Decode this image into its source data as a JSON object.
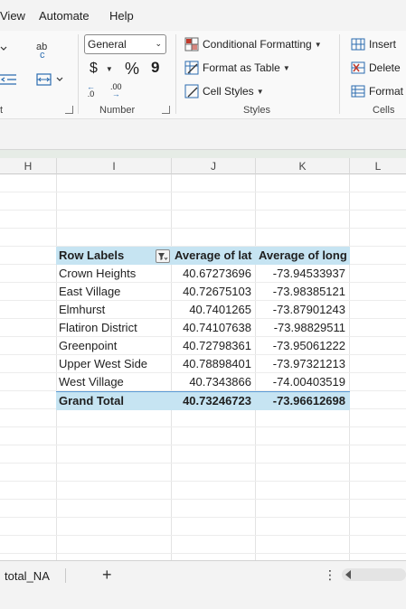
{
  "menubar": {
    "items": [
      "View",
      "Automate",
      "Help"
    ]
  },
  "ribbon": {
    "alignment": {
      "group_label_partial": "t",
      "wrap_glyph": "ab",
      "wrap_glyph2": "c"
    },
    "number": {
      "format_value": "General",
      "currency_symbol": "$",
      "percent_symbol": "%",
      "comma_symbol": "9",
      "increase_decimal": ".0",
      "decrease_decimal": ".00",
      "group_label": "Number"
    },
    "styles": {
      "conditional_formatting": "Conditional Formatting",
      "format_as_table": "Format as Table",
      "cell_styles": "Cell Styles",
      "group_label": "Styles"
    },
    "cells": {
      "insert": "Insert",
      "delete": "Delete",
      "format": "Format",
      "group_label": "Cells"
    }
  },
  "columns": [
    "H",
    "I",
    "J",
    "K",
    "L"
  ],
  "pivot": {
    "headers": [
      "Row Labels",
      "Average of lat",
      "Average of long"
    ],
    "rows": [
      {
        "label": "Crown Heights",
        "lat": "40.67273696",
        "long": "-73.94533937"
      },
      {
        "label": "East Village",
        "lat": "40.72675103",
        "long": "-73.98385121"
      },
      {
        "label": "Elmhurst",
        "lat": "40.7401265",
        "long": "-73.87901243"
      },
      {
        "label": "Flatiron District",
        "lat": "40.74107638",
        "long": "-73.98829511"
      },
      {
        "label": "Greenpoint",
        "lat": "40.72798361",
        "long": "-73.95061222"
      },
      {
        "label": "Upper West Side",
        "lat": "40.78898401",
        "long": "-73.97321213"
      },
      {
        "label": "West Village",
        "lat": "40.7343866",
        "long": "-74.00403519"
      }
    ],
    "total": {
      "label": "Grand Total",
      "lat": "40.73246723",
      "long": "-73.96612698"
    }
  },
  "sheets": {
    "active_tab": "total_NA",
    "add_label": "+",
    "more_label": "⋮"
  },
  "colors": {
    "pivot_header_fill": "#c6e4f2",
    "accent_red": "#c0392b",
    "accent_blue": "#2b6cb0"
  }
}
